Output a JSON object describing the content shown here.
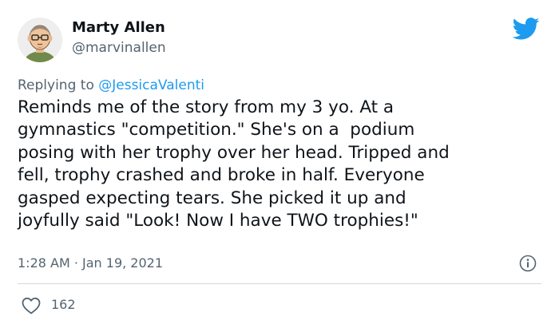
{
  "author": {
    "name": "Marty Allen",
    "handle": "@marvinallen"
  },
  "reply": {
    "prefix": "Replying to",
    "mention": "@JessicaValenti"
  },
  "tweet_text_lines": [
    "Reminds me of the story from my 3 yo. At a",
    "gymnastics \"competition.\" She's on a  podium",
    "posing with her trophy over her head. Tripped and",
    "fell, trophy crashed and broke in half. Everyone",
    "gasped expecting tears. She picked it up and",
    "joyfully said \"Look! Now I have TWO trophies!\""
  ],
  "timestamp": "1:28 AM · Jan 19, 2021",
  "likes": "162",
  "icons": {
    "brand": "twitter-bird-icon",
    "info": "info-icon",
    "like": "heart-icon"
  },
  "colors": {
    "brand": "#1d9bf0",
    "text": "#0f1419",
    "secondary": "#536471",
    "divider": "#cfd9de"
  }
}
